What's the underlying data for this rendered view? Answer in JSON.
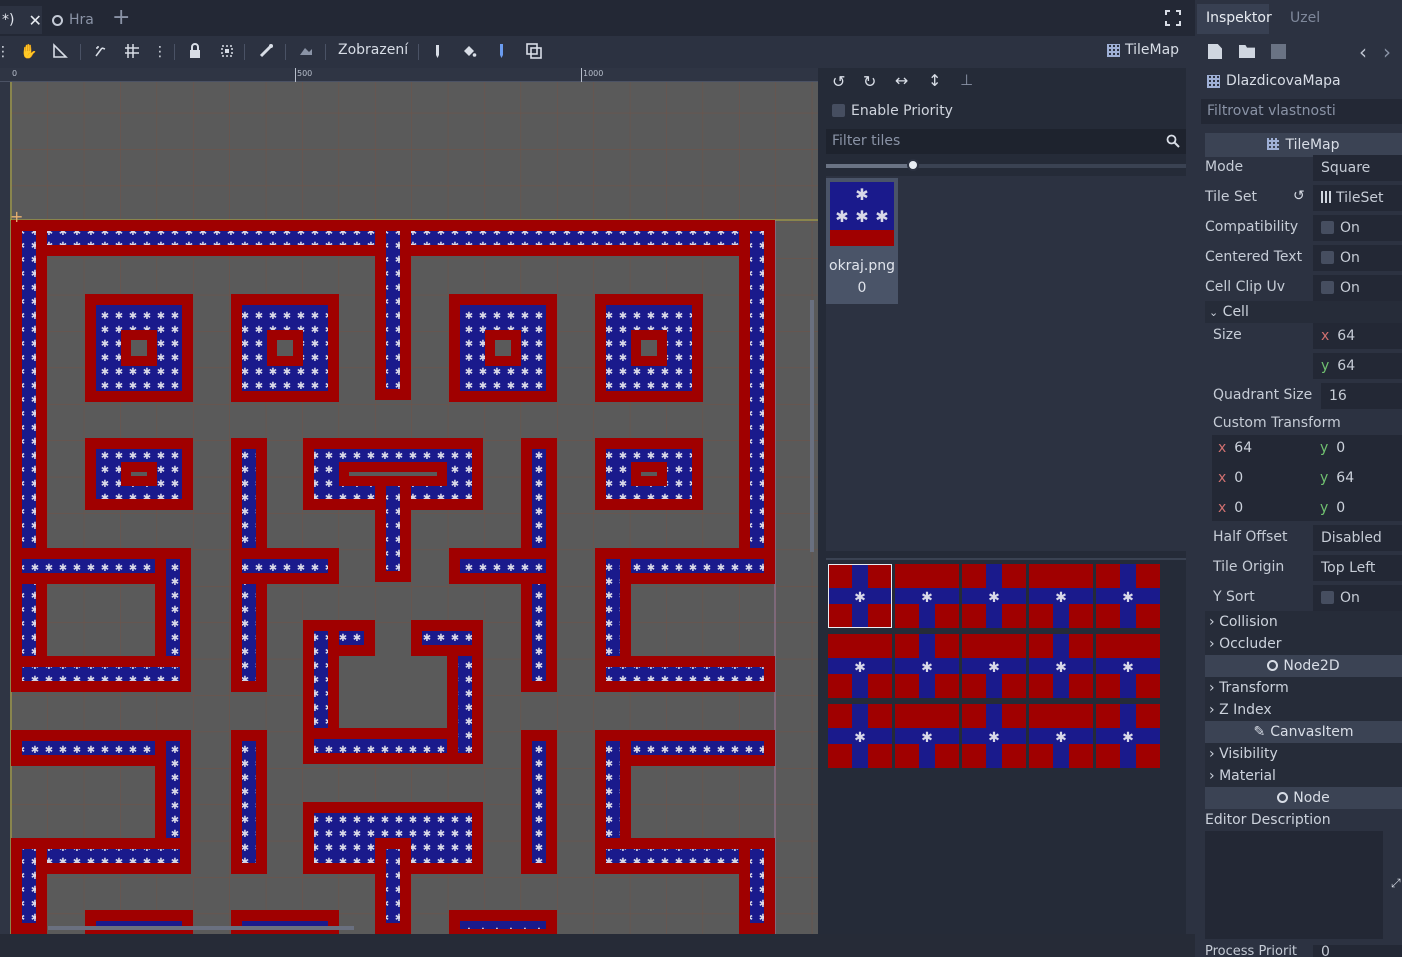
{
  "tabs": [
    {
      "label": "*)",
      "active": true
    },
    {
      "label": "Hra",
      "active": false
    }
  ],
  "toolbar": {
    "view_menu": "Zobrazení",
    "tilemap_label": "TileMap"
  },
  "ruler": {
    "marks": [
      "0",
      "500",
      "1000"
    ]
  },
  "tile_panel": {
    "enable_priority": "Enable Priority",
    "filter_placeholder": "Filter tiles",
    "tile_name": "okraj.png",
    "tile_index": "0"
  },
  "inspector": {
    "tabs": [
      "Inspektor",
      "Uzel"
    ],
    "node_name": "DlazdicovaMapa",
    "filter_placeholder": "Filtrovat vlastnosti",
    "class_header": "TileMap",
    "mode_label": "Mode",
    "mode_value": "Square",
    "tileset_label": "Tile Set",
    "tileset_value": "TileSet",
    "compat_label": "Compatibility",
    "compat_value": "On",
    "centered_label": "Centered Text",
    "centered_value": "On",
    "clip_label": "Cell Clip Uv",
    "clip_value": "On",
    "cell_section": "Cell",
    "size_label": "Size",
    "size_x": "64",
    "size_y": "64",
    "quadrant_label": "Quadrant Size",
    "quadrant_value": "16",
    "custom_transform_label": "Custom Transform",
    "ct": [
      [
        "64",
        "0"
      ],
      [
        "0",
        "64"
      ],
      [
        "0",
        "0"
      ]
    ],
    "half_offset_label": "Half Offset",
    "half_offset_value": "Disabled",
    "tile_origin_label": "Tile Origin",
    "tile_origin_value": "Top Left",
    "ysort_label": "Y Sort",
    "ysort_value": "On",
    "collision": "Collision",
    "occluder": "Occluder",
    "node2d": "Node2D",
    "transform": "Transform",
    "zindex": "Z Index",
    "canvasitem": "CanvasItem",
    "visibility": "Visibility",
    "material": "Material",
    "node": "Node",
    "editor_description": "Editor Description",
    "process_priority": "Process Priorit",
    "process_priority_value": "0"
  },
  "colors": {
    "wall_red": "#a00000",
    "wall_blue": "#1a1a8c",
    "star": "#d8d8e8",
    "floor": "#5a5a5a",
    "accent": "#6b9cf0"
  }
}
